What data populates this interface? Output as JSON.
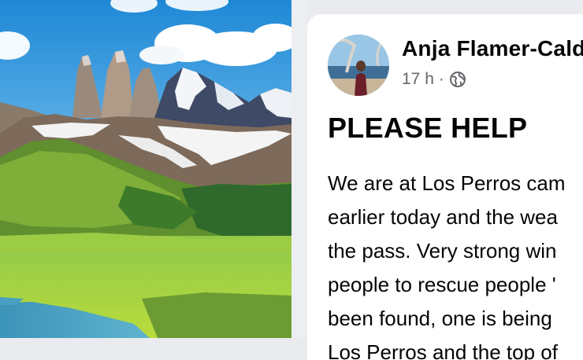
{
  "post": {
    "author": "Anja Flamer-Calde",
    "time": "17 h",
    "separator": "·",
    "privacy_icon": "globe-icon",
    "title": "PLEASE HELP",
    "body_lines": [
      "We are at Los Perros cam",
      "earlier today and the wea",
      "the pass. Very strong win",
      "people to rescue people '",
      "been found, one is being",
      "Los Perros and the top of"
    ]
  },
  "colors": {
    "page_background": "#e9ebee",
    "card_background": "#ffffff",
    "text_primary": "#050505",
    "text_secondary": "#65676b"
  }
}
